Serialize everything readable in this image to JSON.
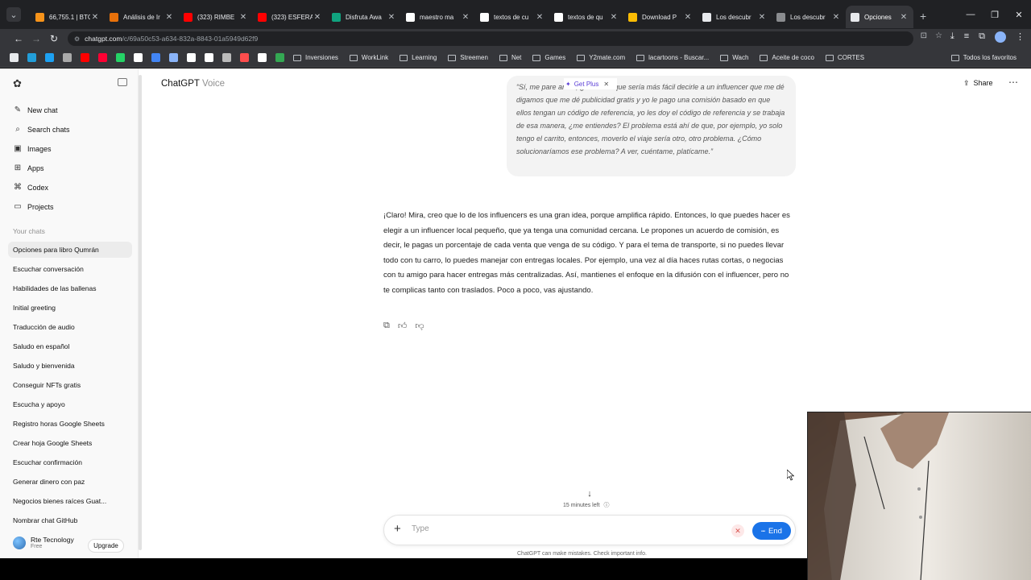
{
  "browser": {
    "tabs": [
      {
        "title": "66,755.1 | BTC",
        "color": "#f7931a"
      },
      {
        "title": "Análisis de Ir",
        "color": "#e8710a"
      },
      {
        "title": "(323) RIMBE",
        "color": "#ff0000"
      },
      {
        "title": "(323) ESFERA",
        "color": "#ff0000"
      },
      {
        "title": "Disfruta Awa",
        "color": "#10a37f"
      },
      {
        "title": "maestro ma",
        "color": "#ffffff"
      },
      {
        "title": "textos de cu",
        "color": "#ffffff"
      },
      {
        "title": "textos de qu",
        "color": "#ffffff"
      },
      {
        "title": "Download P",
        "color": "#fbbc04"
      },
      {
        "title": "Los descubr",
        "color": "#e8eaed"
      },
      {
        "title": "Los descubr",
        "color": "#8a8c8f"
      },
      {
        "title": "Opciones",
        "color": "#e8eaed"
      }
    ],
    "url_host": "chatgpt.com",
    "url_path": "/c/69a50c53-a634-832a-8843-01a5949d62f9",
    "bookmarks": [
      "Inversiones",
      "WorkLink",
      "Learning",
      "Streemen",
      "Net",
      "Games",
      "Y2mate.com",
      "lacartoons - Buscar...",
      "Wach",
      "Aceite de coco",
      "CORTES"
    ],
    "bookmarks_all": "Todos los favoritos",
    "bookmark_icon_colors": [
      "#e8eaed",
      "#229ed9",
      "#1da1f2",
      "#aaaaaa",
      "#ff0000",
      "#ff0033",
      "#25d366",
      "#ffffff",
      "#4285f4",
      "#8ab4f8",
      "#ffffff",
      "#ffffff",
      "#bbbbbb",
      "#ff4d4d",
      "#ffffff",
      "#34a853"
    ]
  },
  "sidebar": {
    "menu": [
      {
        "label": "New chat",
        "icon": "✎",
        "name": "new-chat"
      },
      {
        "label": "Search chats",
        "icon": "⌕",
        "name": "search-chats"
      },
      {
        "label": "Images",
        "icon": "▣",
        "name": "images"
      },
      {
        "label": "Apps",
        "icon": "⊞",
        "name": "apps"
      },
      {
        "label": "Codex",
        "icon": "⌘",
        "name": "codex"
      },
      {
        "label": "Projects",
        "icon": "▭",
        "name": "projects"
      }
    ],
    "section_label": "Your chats",
    "chats": [
      "Opciones para libro Qumrán",
      "Escuchar conversación",
      "Habilidades de las ballenas",
      "Initial greeting",
      "Traducción de audio",
      "Saludo en español",
      "Saludo y bienvenida",
      "Conseguir NFTs gratis",
      "Escucha y apoyo",
      "Registro horas Google Sheets",
      "Crear hoja Google Sheets",
      "Escuchar confirmación",
      "Generar dinero con paz",
      "Negocios bienes raíces Guat...",
      "Nombrar chat GitHub"
    ],
    "account_name": "Rte Tecnology",
    "account_plan": "Free",
    "upgrade_label": "Upgrade"
  },
  "header": {
    "title": "ChatGPT",
    "subtitle": "Voice",
    "get_plus": "Get Plus",
    "share": "Share"
  },
  "conversation": {
    "user_message": "“Sí, me pare                  amos, ¿no crees que sería más fácil decirle a un influencer que me dé digamos que me dé publicidad gratis y yo le pago una comisión basado en que ellos tengan un código de referencia, yo les doy el código de referencia y se trabaja de esa manera, ¿me entiendes? El problema está ahí de que, por ejemplo, yo solo tengo el carrito, entonces, moverlo el viaje sería otro, otro problema. ¿Cómo solucionaríamos ese problema? A ver, cuéntame, platícame.”",
    "assistant_message": "¡Claro! Mira, creo que lo de los influencers es una gran idea, porque amplifica rápido. Entonces, lo que puedes hacer es elegir a un influencer local pequeño, que ya tenga una comunidad cercana. Le propones un acuerdo de comisión, es decir, le pagas un porcentaje de cada venta que venga de su código. Y para el tema de transporte, si no puedes llevar todo con tu carro, lo puedes manejar con entregas locales. Por ejemplo, una vez al día haces rutas cortas, o negocias con tu amigo para hacer entregas más centralizadas. Así, mantienes el enfoque en la difusión con el influencer, pero no te complicas tanto con traslados. Poco a poco, vas ajustando."
  },
  "voice": {
    "time_left": "15 minutes left",
    "placeholder": "Type",
    "end_label": "End"
  },
  "disclaimer": "ChatGPT can make mistakes. Check important info."
}
